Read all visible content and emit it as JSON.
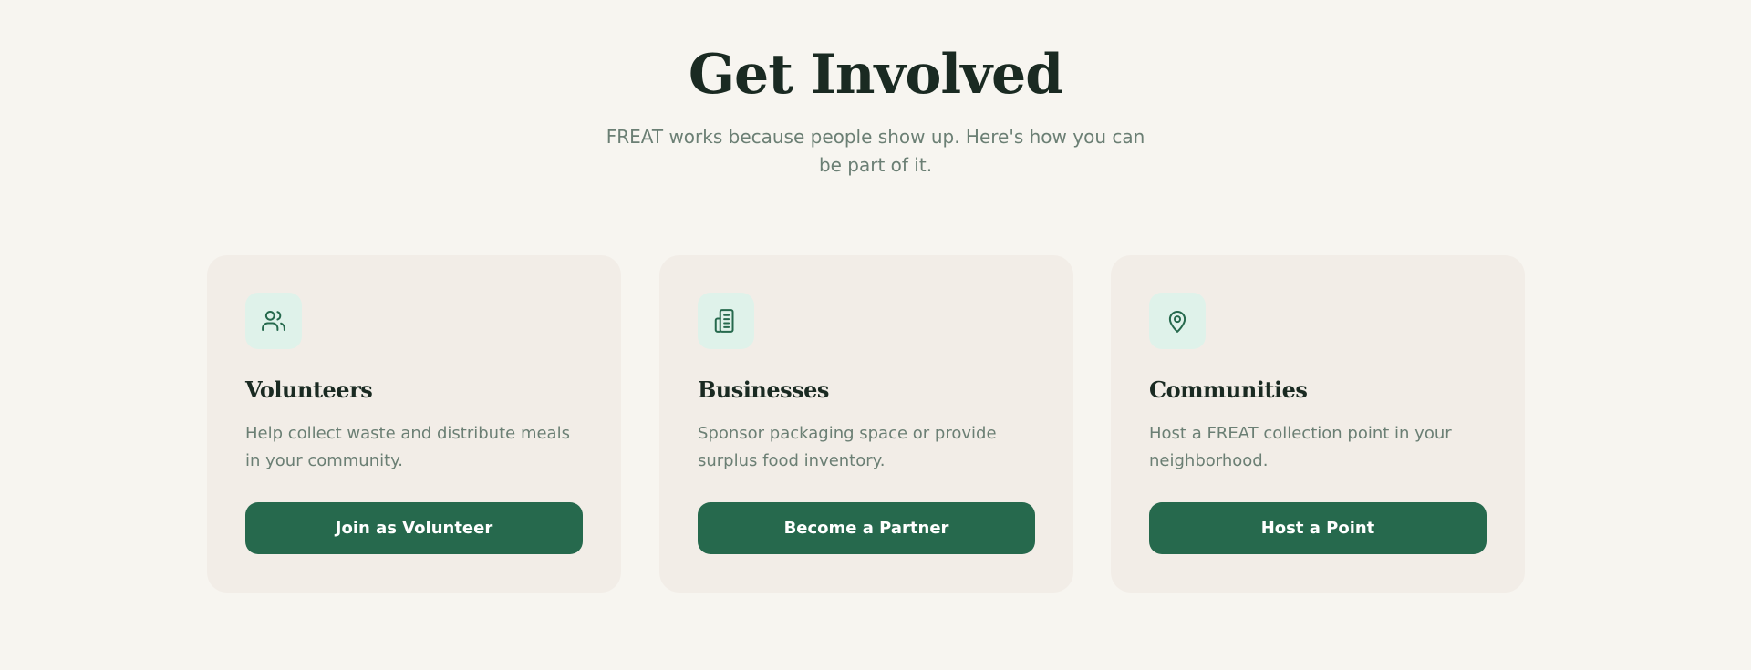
{
  "section": {
    "title": "Get Involved",
    "subtitle": "FREAT works because people show up. Here's how you can be part of it."
  },
  "colors": {
    "background": "#f7f5f0",
    "card_background": "#f2ede7",
    "icon_background": "#dff2ea",
    "accent": "#26694d",
    "heading_text": "#1a2a22",
    "body_text": "#6b7f74"
  },
  "cards": [
    {
      "icon": "users-icon",
      "title": "Volunteers",
      "description": "Help collect waste and distribute meals in your community.",
      "button_label": "Join as Volunteer"
    },
    {
      "icon": "building-icon",
      "title": "Businesses",
      "description": "Sponsor packaging space or provide surplus food inventory.",
      "button_label": "Become a Partner"
    },
    {
      "icon": "map-pin-icon",
      "title": "Communities",
      "description": "Host a FREAT collection point in your neighborhood.",
      "button_label": "Host a Point"
    }
  ]
}
